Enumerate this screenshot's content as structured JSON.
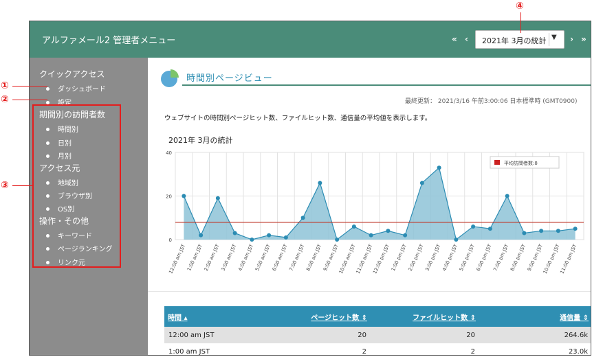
{
  "header": {
    "app_title": "アルファメール2 管理者メニュー",
    "nav_first": "«",
    "nav_prev": "‹",
    "nav_next": "›",
    "nav_last": "»",
    "month_selected": "2021年 3月の統計"
  },
  "sidebar": {
    "quick_access": "クイックアクセス",
    "quick_items": [
      "ダッシュボード",
      "設定"
    ],
    "visitors_section": "期間別の訪問者数",
    "visitors_items": [
      "時間別",
      "日別",
      "月別"
    ],
    "source_section": "アクセス元",
    "source_items": [
      "地域別",
      "ブラウザ別",
      "OS別"
    ],
    "other_section": "操作・その他",
    "other_items": [
      "キーワード",
      "ページランキング",
      "リンク元"
    ]
  },
  "main": {
    "page_title": "時間別ページビュー",
    "last_updated": "最終更新： 2021/3/16 午前3:00:06 日本標準時 (GMT0900)",
    "description": "ウェブサイトの時間別ページヒット数、ファイルヒット数、通信量の平均値を表示します。",
    "chart_title": "2021年 3月の統計"
  },
  "chart_data": {
    "type": "area",
    "title": "2021年 3月の統計",
    "categories": [
      "12:00 am JST",
      "1:00 am JST",
      "2:00 am JST",
      "3:00 am JST",
      "4:00 am JST",
      "5:00 am JST",
      "6:00 am JST",
      "7:00 am JST",
      "8:00 am JST",
      "9:00 am JST",
      "10:00 am JST",
      "11:00 am JST",
      "12:00 pm JST",
      "1:00 pm JST",
      "2:00 pm JST",
      "3:00 pm JST",
      "4:00 pm JST",
      "5:00 pm JST",
      "6:00 pm JST",
      "7:00 pm JST",
      "8:00 pm JST",
      "9:00 pm JST",
      "10:00 pm JST",
      "11:00 pm JST"
    ],
    "values": [
      20,
      2,
      19,
      3,
      0,
      2,
      1,
      10,
      26,
      0,
      6,
      2,
      4,
      2,
      26,
      33,
      0,
      6,
      5,
      20,
      3,
      4,
      4,
      5
    ],
    "average": 8,
    "legend": "平均訪問者数:8",
    "yticks": [
      0,
      20,
      40
    ],
    "ylim": [
      0,
      40
    ],
    "grid": true,
    "legend_position": "top-right",
    "colors": {
      "area": "#8ec3d7",
      "line": "#2b8cb3",
      "average": "#c0392b"
    }
  },
  "table": {
    "headers": [
      "時間 ▴",
      "ページヒット数 ⇕",
      "ファイルヒット数 ⇕",
      "通信量 ⇕"
    ],
    "rows": [
      [
        "12:00 am JST",
        "20",
        "20",
        "264.6k"
      ],
      [
        "1:00 am JST",
        "2",
        "2",
        "23.0k"
      ]
    ]
  },
  "callouts": [
    "①",
    "②",
    "③",
    "④"
  ]
}
